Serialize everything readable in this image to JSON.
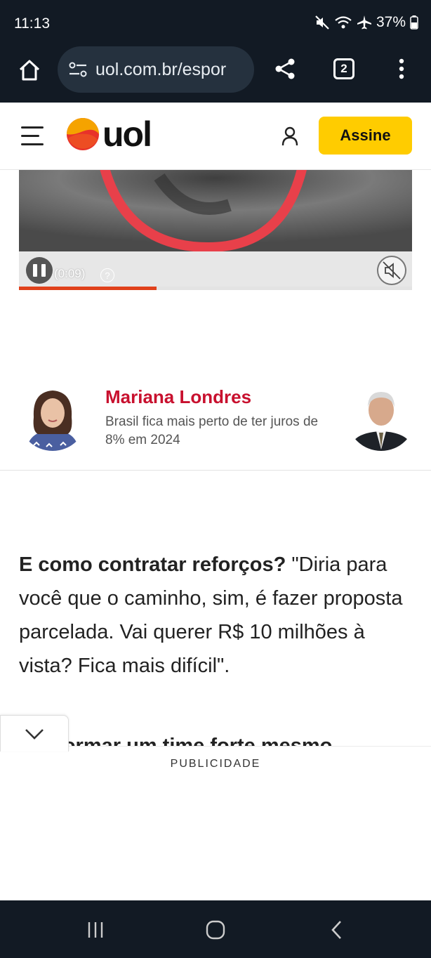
{
  "status_bar": {
    "time": "11:13",
    "battery": "37%"
  },
  "browser": {
    "url": "uol.com.br/espor",
    "tab_count": "2"
  },
  "header": {
    "logo_text": "uol",
    "subscribe_label": "Assine",
    "colors": {
      "subscribe_bg": "#ffcc00",
      "logo_orange": "#f5a300",
      "logo_red": "#e8322a"
    }
  },
  "video": {
    "time_label": "(0:09)",
    "progress": 0.35,
    "colors": {
      "progress": "#e0411b"
    }
  },
  "columnist": {
    "name": "Mariana Londres",
    "headline": "Brasil fica mais perto de ter juros de 8% em 2024",
    "colors": {
      "name": "#c8102e"
    }
  },
  "article": {
    "lead_bold": "E como contratar reforços?",
    "lead_text": " \"Diria para você que o caminho, sim, é fazer proposta parcelada. Vai querer R$ 10 milhões à vista? Fica mais difícil\".",
    "next_line": "ora formar um time forte mesmo"
  },
  "ad": {
    "label": "PUBLICIDADE"
  }
}
